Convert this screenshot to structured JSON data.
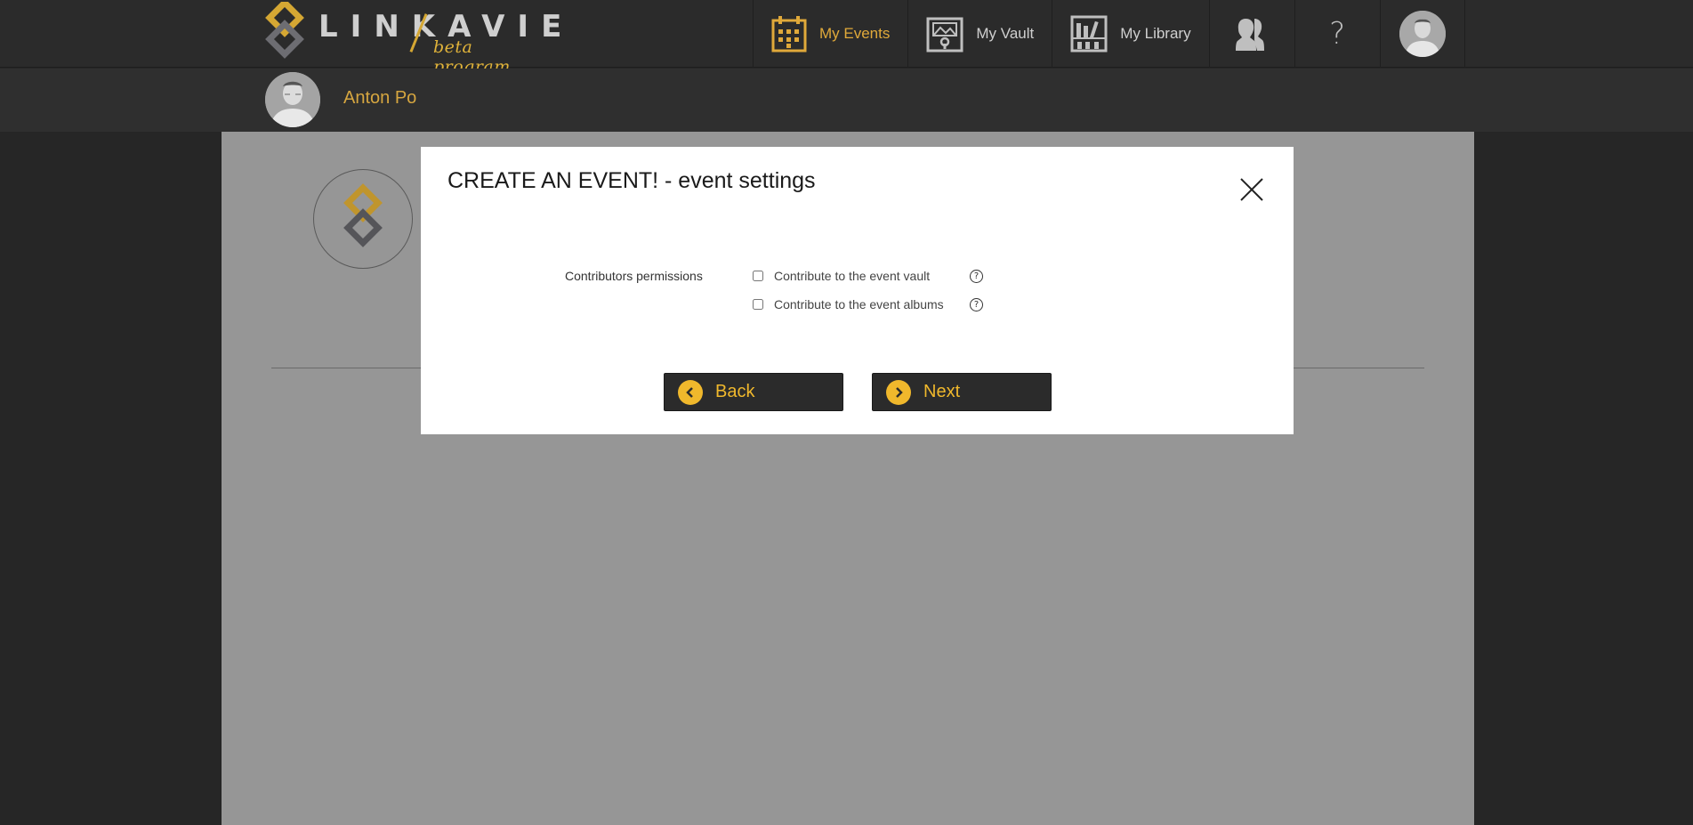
{
  "brand": {
    "name": "LINKAVIE",
    "tagline": "beta program",
    "accent": "#e0a93a"
  },
  "nav": {
    "items": [
      {
        "label": "My Events",
        "icon": "calendar-icon",
        "active": true
      },
      {
        "label": "My Vault",
        "icon": "vault-icon",
        "active": false
      },
      {
        "label": "My Library",
        "icon": "library-icon",
        "active": false
      }
    ],
    "contacts_icon": "contacts-icon",
    "help_glyph": "?",
    "profile_icon": "user-avatar"
  },
  "user": {
    "name": "Anton Po"
  },
  "modal": {
    "title": "CREATE AN EVENT! - event settings",
    "section_label": "Contributors permissions",
    "options": [
      {
        "label": "Contribute to the event vault",
        "checked": false
      },
      {
        "label": "Contribute to the event albums",
        "checked": false
      }
    ],
    "help_glyph": "?",
    "back_label": "Back",
    "next_label": "Next"
  }
}
